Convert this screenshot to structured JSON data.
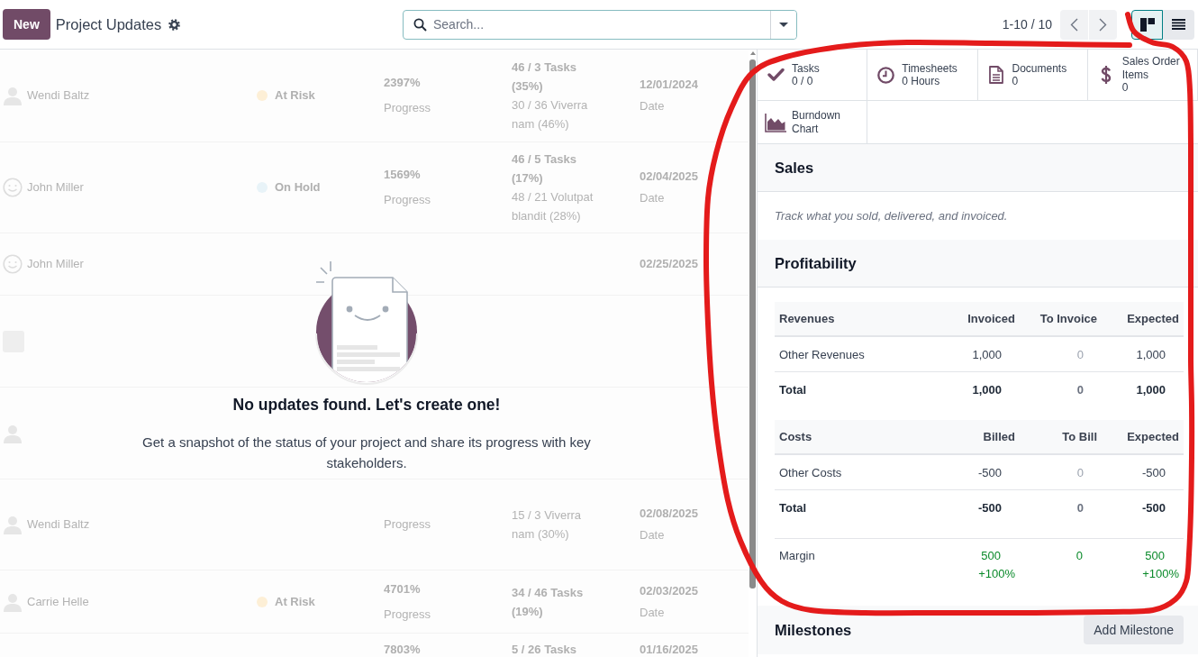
{
  "control_panel": {
    "new_button": "New",
    "breadcrumb": "Project Updates",
    "search": {
      "placeholder": "Search..."
    },
    "pager": "1-10 / 10",
    "views": [
      {
        "kind": "kanban",
        "selected": true
      },
      {
        "kind": "list",
        "selected": false
      }
    ]
  },
  "sample_rows": [
    {
      "avatar": {
        "kind": "person"
      },
      "name": "Wendi Baltz",
      "status": {
        "label": "At Risk",
        "color": "#fdefd6"
      },
      "progress": "2397%",
      "progress_caption": "Progress",
      "tasks": "46 / 3 Tasks (35%)",
      "milestones": "30 / 36 Viverra nam (46%)",
      "date": "12/01/2024",
      "date_caption": "Date"
    },
    {
      "avatar": {
        "kind": "smiley"
      },
      "name": "John Miller",
      "status": {
        "label": "On Hold",
        "color": "#e8f3f8"
      },
      "progress": "1569%",
      "progress_caption": "Progress",
      "tasks": "46 / 5 Tasks (17%)",
      "milestones": "48 / 21 Volutpat blandit (28%)",
      "date": "02/04/2025",
      "date_caption": "Date"
    },
    {
      "avatar": {
        "kind": "smiley"
      },
      "name": "John Miller",
      "date": "02/25/2025"
    },
    {
      "avatar": {
        "kind": "photo"
      }
    },
    {
      "avatar": {
        "kind": "person"
      }
    },
    {
      "avatar": {
        "kind": "person"
      },
      "name": "Wendi Baltz",
      "progress_caption": "Progress",
      "milestones": "15 / 3 Viverra nam (30%)",
      "date": "02/08/2025",
      "date_caption": "Date"
    },
    {
      "avatar": {
        "kind": "person"
      },
      "name": "Carrie Helle",
      "status": {
        "label": "At Risk",
        "color": "#fdefd6"
      },
      "progress": "4701%",
      "progress_caption": "Progress",
      "tasks": "34 / 46 Tasks (19%)",
      "date": "02/03/2025",
      "date_caption": "Date"
    },
    {
      "progress": "7803%",
      "tasks": "5 / 26 Tasks",
      "date": "01/16/2025"
    }
  ],
  "empty_state": {
    "title": "No updates found. Let's create one!",
    "text": "Get a snapshot of the status of your project and share its progress with key stakeholders."
  },
  "side_panel": {
    "stat_buttons": [
      {
        "kind": "tasks",
        "label": "Tasks",
        "value": "0 / 0"
      },
      {
        "kind": "timesheets",
        "label": "Timesheets",
        "value": "0 Hours"
      },
      {
        "kind": "documents",
        "label": "Documents",
        "value": "0"
      },
      {
        "kind": "sales_order_items",
        "label": "Sales Order Items",
        "value": "0"
      },
      {
        "kind": "burndown",
        "label": "Burndown Chart"
      }
    ],
    "sales": {
      "title": "Sales",
      "text": "Track what you sold, delivered, and invoiced."
    },
    "profitability": {
      "title": "Profitability",
      "tables": [
        {
          "columns": [
            "Revenues",
            "Invoiced",
            "To Invoice",
            "Expected"
          ],
          "rows": [
            {
              "kind": "line",
              "label": "Other Revenues",
              "values": [
                {
                  "text": "1,000",
                  "muted": false
                },
                {
                  "text": "0",
                  "muted": true
                },
                {
                  "text": "1,000",
                  "muted": false
                }
              ]
            },
            {
              "kind": "total",
              "label": "Total",
              "values": [
                {
                  "text": "1,000",
                  "muted": false
                },
                {
                  "text": "0",
                  "muted": true
                },
                {
                  "text": "1,000",
                  "muted": false
                }
              ]
            }
          ]
        },
        {
          "columns": [
            "Costs",
            "Billed",
            "To Bill",
            "Expected"
          ],
          "rows": [
            {
              "kind": "line",
              "label": "Other Costs",
              "values": [
                {
                  "text": "-500",
                  "muted": false
                },
                {
                  "text": "0",
                  "muted": true
                },
                {
                  "text": "-500",
                  "muted": false
                }
              ]
            },
            {
              "kind": "total",
              "label": "Total",
              "values": [
                {
                  "text": "-500",
                  "muted": false
                },
                {
                  "text": "0",
                  "muted": true
                },
                {
                  "text": "-500",
                  "muted": false
                }
              ]
            }
          ]
        }
      ],
      "margin": {
        "label": "Margin",
        "positive": true,
        "cells": [
          {
            "value": "500",
            "percent": "+100%"
          },
          {
            "value": "0"
          },
          {
            "value": "500",
            "percent": "+100%"
          }
        ]
      }
    },
    "milestones": {
      "title": "Milestones",
      "button": "Add Milestone"
    }
  },
  "annotations": [
    {
      "kind": "freehand_loop"
    }
  ]
}
